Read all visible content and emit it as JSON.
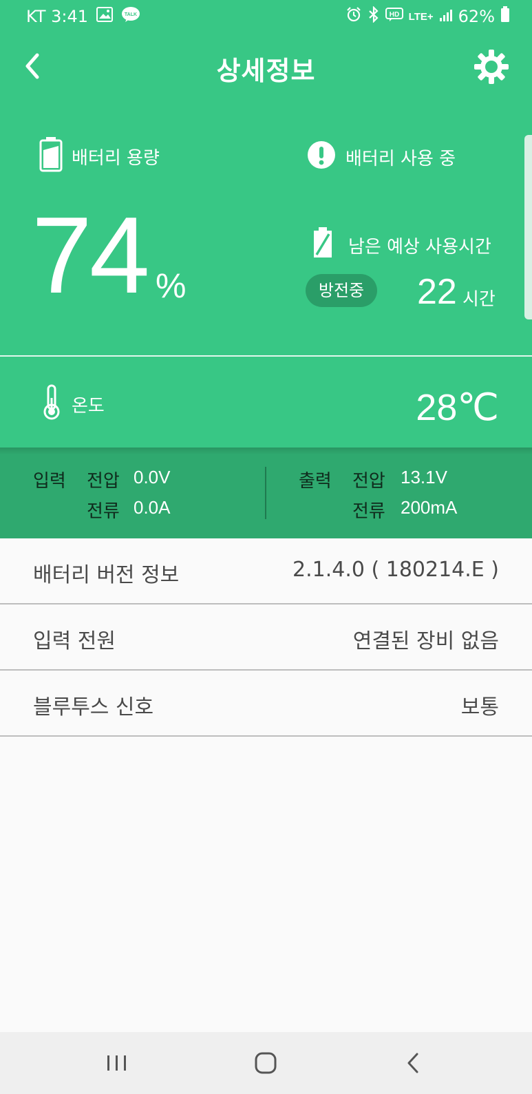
{
  "status_bar": {
    "carrier_time": "KT 3:41",
    "network": "LTE+",
    "battery_percent": "62%"
  },
  "app_bar": {
    "title": "상세정보"
  },
  "battery": {
    "capacity_label": "배터리 용량",
    "usage_label": "배터리 사용 중",
    "percent_value": "74",
    "percent_unit": "%",
    "remaining_label": "남은 예상 사용시간",
    "status_badge": "방전중",
    "remaining_value": "22",
    "remaining_unit": "시간"
  },
  "temperature": {
    "label": "온도",
    "value": "28℃"
  },
  "io": {
    "input": {
      "title": "입력",
      "voltage_label": "전압",
      "voltage_value": "0.0V",
      "current_label": "전류",
      "current_value": "0.0A"
    },
    "output": {
      "title": "출력",
      "voltage_label": "전압",
      "voltage_value": "13.1V",
      "current_label": "전류",
      "current_value": "200mA"
    }
  },
  "info_list": [
    {
      "label": "배터리 버전 정보",
      "value": "2.1.4.0 ( 180214.E )"
    },
    {
      "label": "입력 전원",
      "value": "연결된 장비 없음"
    },
    {
      "label": "블루투스 신호",
      "value": "보통"
    }
  ],
  "colors": {
    "accent": "#38c785",
    "accent_dark": "#2fa96f",
    "badge": "#2a9e68"
  },
  "icons": {
    "back": "chevron-left-icon",
    "settings": "gear-icon",
    "capacity": "battery-icon",
    "usage": "exclamation-circle-icon",
    "remaining": "battery-charging-icon",
    "temperature": "thermometer-icon"
  }
}
